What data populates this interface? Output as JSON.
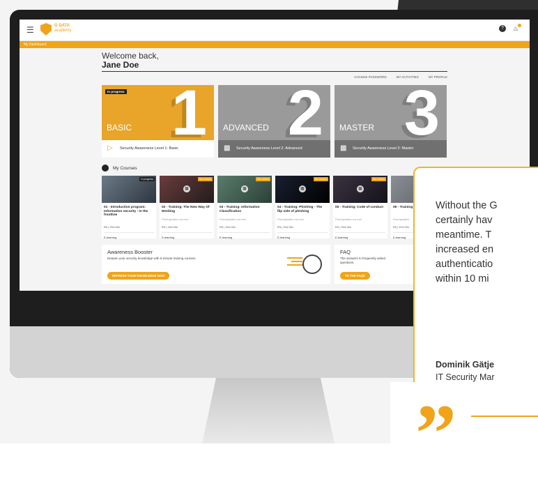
{
  "app": {
    "logo_line1": "G DATA",
    "logo_line2": "academy",
    "breadcrumb": "My Dashboard",
    "help_icon": "?"
  },
  "welcome": {
    "greeting": "Welcome back,",
    "name": "Jane Doe"
  },
  "top_links": [
    "CHANGE PASSWORD",
    "MY ACTIVITIES",
    "MY PROFILE"
  ],
  "levels": [
    {
      "number": "1",
      "title": "BASIC",
      "status": "In progress",
      "label": "Security Awareness Level 1: Basic",
      "color": "#e8a52a"
    },
    {
      "number": "2",
      "title": "ADVANCED",
      "label": "Security Awareness Level 2: Advanced",
      "color": "#9a9a9a"
    },
    {
      "number": "3",
      "title": "MASTER",
      "label": "Security Awareness Level 3: Master",
      "color": "#9a9a9a"
    }
  ],
  "courses_section": {
    "title": "My Courses"
  },
  "courses": [
    {
      "badge": "In progress",
      "title": "01 - Introduction program: Information security - In the frontline",
      "prereq": "",
      "meta": "EN  |  20m 00s",
      "type": "E-learning"
    },
    {
      "badge": "Not started",
      "title": "02 - Training: The New Way Of Working",
      "prereq": "Prerequisites not met",
      "meta": "EN  |  15m 00s",
      "type": "E-learning"
    },
    {
      "badge": "Not started",
      "title": "03 - Training: Information Classification",
      "prereq": "Prerequisites not met",
      "meta": "EN  |  15m 00s",
      "type": "E-learning"
    },
    {
      "badge": "Not started",
      "title": "04 - Training: Phishing - The flip side of phishing",
      "prereq": "Prerequisites not met",
      "meta": "EN  |  15m 00s",
      "type": "E-learning"
    },
    {
      "badge": "Not started",
      "title": "05 - Training: Code of conduct",
      "prereq": "Prerequisites not met",
      "meta": "EN  |  15m 00s",
      "type": "E-learning"
    },
    {
      "badge": "",
      "title": "06 - Training",
      "prereq": "Prerequisites",
      "meta": "EN  |  20m 00s",
      "type": "E-learning"
    }
  ],
  "booster": {
    "title": "Awareness Booster",
    "subtitle": "Deepen your security knowledge with 5-minute training courses.",
    "button": "REFRESH YOUR KNOWLEDGE NOW"
  },
  "faq": {
    "title": "FAQ",
    "subtitle": "The answers to frequently asked questions.",
    "button": "TO THE FAQS"
  },
  "quote": {
    "lines": [
      "Without the G",
      "certainly hav",
      "meantime. T",
      "increased en",
      "authenticatio",
      "within 10 mi"
    ],
    "author": "Dominik Gätje",
    "role": "IT Security Mar",
    "mark": "”"
  },
  "colors": {
    "accent": "#f0a419",
    "dark": "#1e1e1e"
  }
}
